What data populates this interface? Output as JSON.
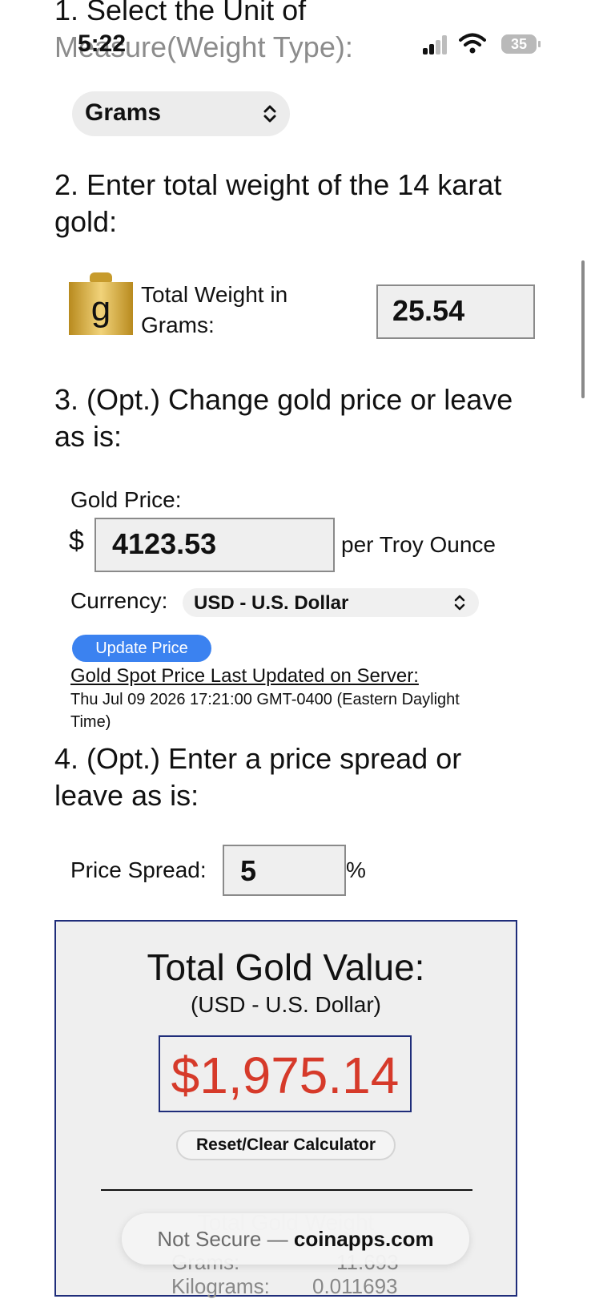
{
  "status_bar": {
    "time": "5:22",
    "battery": "35"
  },
  "step1": {
    "line1": "1. Select the Unit of",
    "line2": "Measure(Weight Type):",
    "unit_select": "Grams"
  },
  "step2": {
    "line1": "2. Enter total weight of the 14 karat",
    "line2": "gold:",
    "icon_letter": "g",
    "weight_label_1": "Total Weight in",
    "weight_label_2": "Grams:",
    "weight_value": "25.54"
  },
  "step3": {
    "line1": "3. (Opt.) Change gold price or leave",
    "line2": "as is:",
    "gold_price_label": "Gold Price:",
    "currency_symbol": "$",
    "gold_price_value": "4123.53",
    "per_unit": "per Troy Ounce",
    "currency_label": "Currency:",
    "currency_select": "USD - U.S. Dollar",
    "update_button": "Update Price",
    "last_updated_link": "Gold Spot Price Last Updated on Server:",
    "last_updated_line1": "Thu Jul 09 2026 17:21:00 GMT-0400 (Eastern Daylight",
    "last_updated_line2": "Time)"
  },
  "step4": {
    "line1": "4. (Opt.) Enter a price spread or",
    "line2": "leave as is:",
    "spread_label": "Price Spread:",
    "spread_value": "5",
    "percent_sign": "%"
  },
  "result": {
    "title": "Total Gold Value:",
    "currency_note": "(USD - U.S. Dollar)",
    "total_value": "$1,975.14",
    "reset_button": "Reset/Clear Calculator",
    "section_heading": "Total Gold Weight",
    "row1_label": "Grams:",
    "row1_value": "11.693",
    "row2_label": "Kilograms:",
    "row2_value": "0.011693"
  },
  "browser": {
    "security": "Not Secure",
    "separator": "—",
    "domain": "coinapps.com"
  },
  "colors": {
    "accent_blue": "#3b82f0",
    "price_red": "#d63a2a",
    "panel_border": "#1f2d7a"
  }
}
